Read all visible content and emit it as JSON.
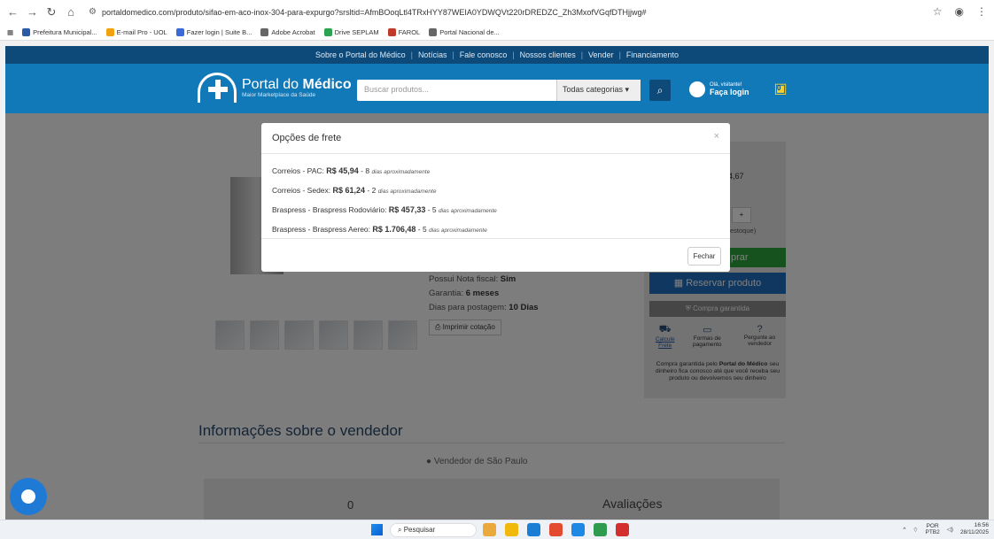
{
  "browser": {
    "url": "portaldomedico.com/produto/sifao-em-aco-inox-304-para-expurgo?srsltid=AfmBOoqLtl4TRxHYY87WEIA0YDWQVt220rDREDZC_Zh3MxofVGqfDTHjjwg#",
    "bookmarks": [
      {
        "label": "Prefeitura Municipal...",
        "color": "#2b5aa8"
      },
      {
        "label": "E-mail Pro - UOL",
        "color": "#f2a20c"
      },
      {
        "label": "Fazer login | Suite B...",
        "color": "#3a6ad8"
      },
      {
        "label": "Adobe Acrobat",
        "color": "#666666"
      },
      {
        "label": "Drive SEPLAM",
        "color": "#2aa44f"
      },
      {
        "label": "FAROL",
        "color": "#c0392b"
      },
      {
        "label": "Portal Nacional de...",
        "color": "#666666"
      }
    ]
  },
  "site": {
    "topnav": [
      "Sobre o Portal do Médico",
      "Notícias",
      "Fale conosco",
      "Nossos clientes",
      "Vender",
      "Financiamento"
    ],
    "logo_title_plain": "Portal do ",
    "logo_title_bold": "Médico",
    "logo_subtitle": "Maior Marketplace da Saúde",
    "search_placeholder": "Buscar produtos...",
    "category": "Todas categorias",
    "login_line1": "Olá, visitante!",
    "login_line2": "Faça login",
    "cart_count": "0"
  },
  "product": {
    "specs": [
      {
        "label": "Possui Nota fiscal: ",
        "value": "Sim"
      },
      {
        "label": "Garantia: ",
        "value": "6 meses"
      },
      {
        "label": "Dias para postagem: ",
        "value": "10 Dias"
      }
    ],
    "print_label": "Imprimir cotação",
    "price_partial": "4,67",
    "plus": "+",
    "stock_partial": "estoque)",
    "buy_partial": "prar",
    "reserve_label": "Reservar produto",
    "guarantee_btn": "Compra garantida",
    "options": [
      {
        "label": "Calcule Frete"
      },
      {
        "label": "Formas de pagamento"
      },
      {
        "label": "Pergunte ao vendedor"
      }
    ],
    "guarantee_text_pre": "Compra garantida pelo ",
    "guarantee_text_bold": "Portal do Médico",
    "guarantee_text_post": " seu dinheiro fica conosco até que você receba seu produto ou devolvemos seu dinheiro"
  },
  "seller": {
    "title": "Informações sobre o vendedor",
    "location": "Vendedor de São Paulo",
    "count": "0",
    "reviews": "Avaliações"
  },
  "modal": {
    "title": "Opções de frete",
    "close_symbol": "×",
    "options": [
      {
        "carrier": "Correios - PAC: ",
        "price": "R$ 45,94",
        "days": " - 8 ",
        "note": "dias aproximadamente"
      },
      {
        "carrier": "Correios - Sedex: ",
        "price": "R$ 61,24",
        "days": " - 2 ",
        "note": "dias aproximadamente"
      },
      {
        "carrier": "Braspress - Braspress Rodoviário: ",
        "price": "R$ 457,33",
        "days": " - 5 ",
        "note": "dias aproximadamente"
      },
      {
        "carrier": "Braspress - Braspress Aereo: ",
        "price": "R$ 1.706,48",
        "days": " - 5 ",
        "note": "dias aproximadamente"
      }
    ],
    "close_button": "Fechar"
  },
  "taskbar": {
    "search": "Pesquisar",
    "lang1": "POR",
    "lang2": "PTB2",
    "time": "16:56",
    "date": "28/11/2025",
    "apps": [
      "#e9a93c",
      "#f0b90b",
      "#1a7fd4",
      "#e34a2f",
      "#1e88e5",
      "#2e9b4f",
      "#d32f2f"
    ]
  }
}
